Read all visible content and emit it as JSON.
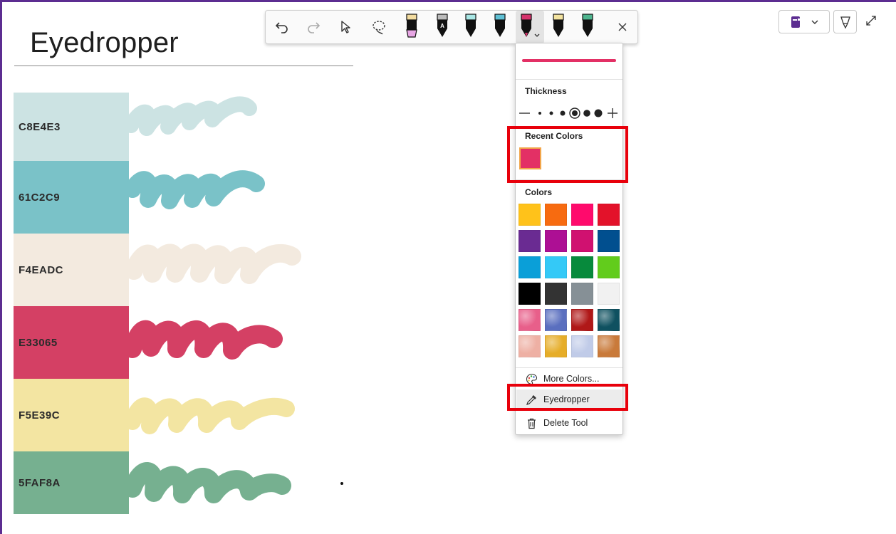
{
  "page": {
    "title": "Eyedropper"
  },
  "swatches": [
    {
      "hex_label": "C8E4E3",
      "color": "#cce3e3"
    },
    {
      "hex_label": "61C2C9",
      "color": "#7ac2c8"
    },
    {
      "hex_label": "F4EADC",
      "color": "#f3eadf"
    },
    {
      "hex_label": "E33065",
      "color": "#d44064"
    },
    {
      "hex_label": "F5E39C",
      "color": "#f3e5a2"
    },
    {
      "hex_label": "5FAF8A",
      "color": "#76b090"
    }
  ],
  "toolbar": {
    "buttons": [
      "undo-icon",
      "redo-icon",
      "select-objects-icon",
      "lasso-select-icon"
    ],
    "pens": [
      {
        "name": "pen-highlighter-purple",
        "accent": "#e7a6e4",
        "cap": "#f3dca0"
      },
      {
        "name": "pen-black-a",
        "accent": "#111111",
        "cap": "#bbbbbb"
      },
      {
        "name": "pen-black-teal-cap",
        "accent": "#111111",
        "cap": "#a9e7e5"
      },
      {
        "name": "pen-black-blue-cap",
        "accent": "#111111",
        "cap": "#5fc0d4"
      },
      {
        "name": "pen-pink-selected",
        "accent": "#d6336c",
        "cap": "#d6336c"
      },
      {
        "name": "pen-yellow-cap",
        "accent": "#111111",
        "cap": "#f3e3a0"
      },
      {
        "name": "pen-green-cap",
        "accent": "#111111",
        "cap": "#4fb58f"
      }
    ],
    "close_icon": "close-icon"
  },
  "top_right": {
    "notebook_icon": "notebook-icon",
    "notebook_color": "#5c2d91",
    "pen_mode_icon": "ink-to-shape-icon",
    "expand_icon": "expand-icon"
  },
  "pen_panel": {
    "preview_color": "#e33065",
    "thickness_label": "Thickness",
    "recent_colors_label": "Recent Colors",
    "recent_colors": [
      "#e33065"
    ],
    "colors_label": "Colors",
    "colors": [
      "#ffc21a",
      "#f76b10",
      "#ff0a6c",
      "#e3122a",
      "#6a2b92",
      "#ad0f94",
      "#d01170",
      "#014f8f",
      "#0a9fd8",
      "#34c9f7",
      "#078a3c",
      "#62cc1c",
      "#000000",
      "#333333",
      "#869096",
      "#f1f1f1"
    ],
    "texture_colors": [
      "#e85f8a",
      "#5a6fbf",
      "#b01818",
      "#0f5160",
      "#eeb0a4",
      "#e6ad28",
      "#c0cbe8",
      "#c97a3a"
    ],
    "more_colors_label": "More Colors...",
    "eyedropper_label": "Eyedropper",
    "delete_tool_label": "Delete Tool"
  },
  "highlight_color": "#e8000b"
}
